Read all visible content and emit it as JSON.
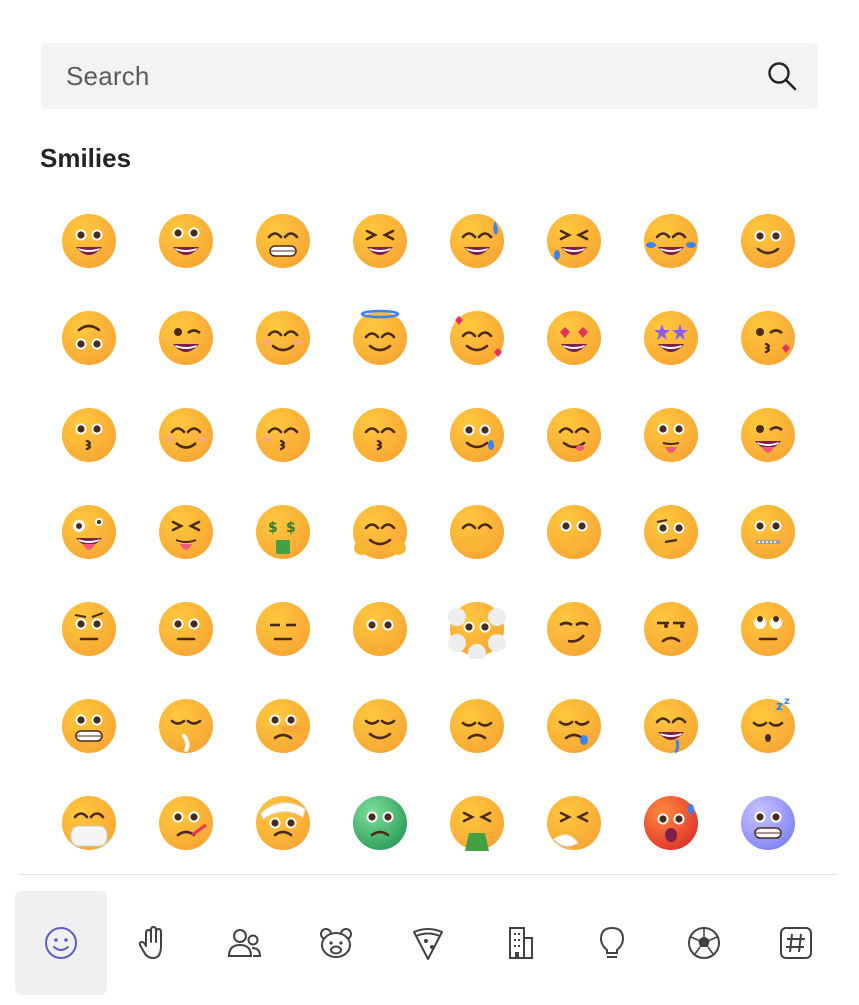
{
  "search": {
    "placeholder": "Search"
  },
  "section": {
    "title": "Smilies"
  },
  "colors": {
    "accent": "#5b5fc7",
    "face": "#ffc83d",
    "face_shade": "#f7a734"
  },
  "emoji_rows": [
    [
      "grinning-face",
      "grinning-face-big-eyes",
      "beaming-face",
      "grinning-squinting-face",
      "grinning-face-with-sweat",
      "rolling-on-floor-laughing",
      "face-with-tears-of-joy",
      "slightly-smiling-face"
    ],
    [
      "upside-down-face",
      "winking-face",
      "smiling-face-with-smiling-eyes",
      "smiling-face-with-halo",
      "smiling-face-with-hearts",
      "smiling-face-with-heart-eyes",
      "star-struck",
      "face-blowing-kiss"
    ],
    [
      "kissing-face",
      "smiling-face",
      "kissing-face-with-closed-eyes",
      "kissing-face-with-smiling-eyes",
      "smiling-face-with-tear",
      "face-savoring-food",
      "face-with-tongue",
      "winking-face-with-tongue"
    ],
    [
      "zany-face",
      "squinting-face-with-tongue",
      "money-mouth-face",
      "hugging-face",
      "face-with-hand-over-mouth",
      "shushing-face",
      "thinking-face",
      "zipper-mouth-face"
    ],
    [
      "face-with-raised-eyebrow",
      "neutral-face",
      "expressionless-face",
      "face-without-mouth",
      "face-in-clouds",
      "smirking-face",
      "unamused-face",
      "face-with-rolling-eyes"
    ],
    [
      "grimacing-face",
      "face-exhaling",
      "lying-face",
      "relieved-face",
      "pensive-face",
      "sleepy-face",
      "drooling-face",
      "sleeping-face"
    ],
    [
      "face-with-medical-mask",
      "face-with-thermometer",
      "face-with-head-bandage",
      "nauseated-face",
      "face-vomiting",
      "sneezing-face",
      "hot-face",
      "cold-face"
    ]
  ],
  "categories": [
    {
      "name": "smilies",
      "icon": "smiley-icon",
      "active": true
    },
    {
      "name": "hands",
      "icon": "hand-icon",
      "active": false
    },
    {
      "name": "people",
      "icon": "people-icon",
      "active": false
    },
    {
      "name": "animals",
      "icon": "bear-icon",
      "active": false
    },
    {
      "name": "food",
      "icon": "pizza-icon",
      "active": false
    },
    {
      "name": "travel",
      "icon": "building-icon",
      "active": false
    },
    {
      "name": "objects",
      "icon": "lightbulb-icon",
      "active": false
    },
    {
      "name": "activities",
      "icon": "soccer-ball-icon",
      "active": false
    },
    {
      "name": "symbols",
      "icon": "hashtag-icon",
      "active": false
    }
  ]
}
